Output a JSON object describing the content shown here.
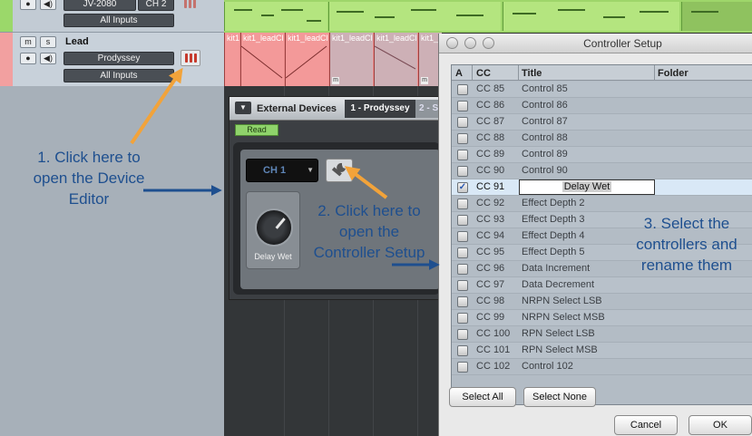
{
  "tracks": {
    "top": {
      "mute": "m",
      "solo": "s",
      "device": "JV-2080",
      "channel": "CH 2",
      "input": "All Inputs"
    },
    "lead": {
      "mute": "m",
      "solo": "s",
      "name": "Lead",
      "device": "Prodyssey",
      "input": "All Inputs"
    }
  },
  "clips": {
    "lead": [
      "kit1_leadCl",
      "kit1_leadCl",
      "kit1_leadCl",
      "kit1_leadCl",
      "kit1_leadCl",
      "kit1_leadCl"
    ],
    "marker": "m"
  },
  "external_devices": {
    "title": "External Devices",
    "active_tab": "1 - Prodyssey",
    "next_tab": "2 - S",
    "read_label": "Read",
    "channel": "CH 1",
    "knob_label": "Delay Wet"
  },
  "controller_setup": {
    "title": "Controller Setup",
    "columns": {
      "a": "A",
      "cc": "CC",
      "title": "Title",
      "folder": "Folder"
    },
    "rows": [
      {
        "cc": "CC 85",
        "title": "Control 85",
        "checked": false
      },
      {
        "cc": "CC 86",
        "title": "Control 86",
        "checked": false
      },
      {
        "cc": "CC 87",
        "title": "Control 87",
        "checked": false
      },
      {
        "cc": "CC 88",
        "title": "Control 88",
        "checked": false
      },
      {
        "cc": "CC 89",
        "title": "Control 89",
        "checked": false
      },
      {
        "cc": "CC 90",
        "title": "Control 90",
        "checked": false
      },
      {
        "cc": "CC 91",
        "title": "Delay Wet",
        "checked": true,
        "editing": true
      },
      {
        "cc": "CC 92",
        "title": "Effect Depth 2",
        "checked": false
      },
      {
        "cc": "CC 93",
        "title": "Effect Depth 3",
        "checked": false
      },
      {
        "cc": "CC 94",
        "title": "Effect Depth 4",
        "checked": false
      },
      {
        "cc": "CC 95",
        "title": "Effect Depth 5",
        "checked": false
      },
      {
        "cc": "CC 96",
        "title": "Data Increment",
        "checked": false
      },
      {
        "cc": "CC 97",
        "title": "Data Decrement",
        "checked": false
      },
      {
        "cc": "CC 98",
        "title": "NRPN Select LSB",
        "checked": false
      },
      {
        "cc": "CC 99",
        "title": "NRPN Select MSB",
        "checked": false
      },
      {
        "cc": "CC 100",
        "title": "RPN Select LSB",
        "checked": false
      },
      {
        "cc": "CC 101",
        "title": "RPN Select MSB",
        "checked": false
      },
      {
        "cc": "CC 102",
        "title": "Control 102",
        "checked": false
      }
    ],
    "buttons": {
      "select_all": "Select All",
      "select_none": "Select None",
      "cancel": "Cancel",
      "ok": "OK"
    }
  },
  "annotations": {
    "step1": "1. Click here to open the Device Editor",
    "step2": "2. Click here to open the Controller Setup",
    "step3": "3. Select the controllers and rename them"
  },
  "colors": {
    "annotation_text": "#1e4f8f",
    "arrow_orange": "#f2a33a",
    "arrow_blue": "#1e4f8f",
    "track_green": "#9ed66a",
    "track_red": "#e98b8b",
    "checkmark": "#2556b0"
  }
}
